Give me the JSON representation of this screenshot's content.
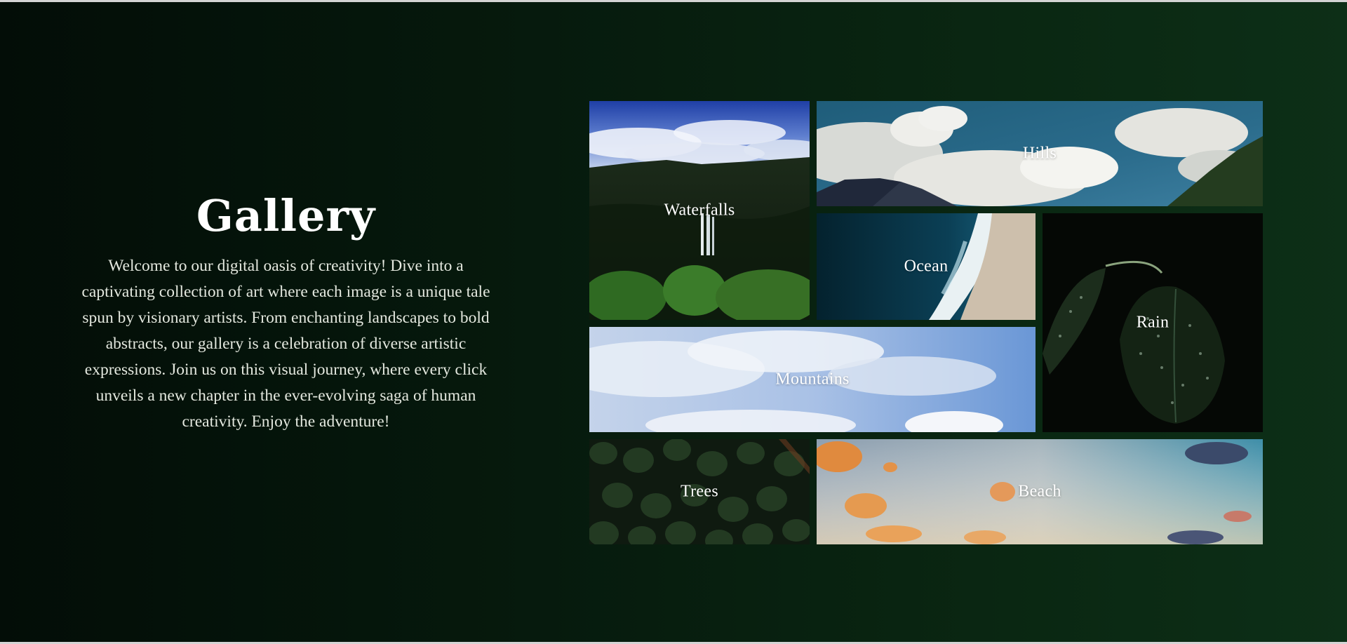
{
  "intro": {
    "title": "Gallery",
    "description": "Welcome to our digital oasis of creativity! Dive into a captivating collection of art where each image is a unique tale spun by visionary artists. From enchanting landscapes to bold abstracts, our gallery is a celebration of diverse artistic expressions. Join us on this visual journey, where every click unveils a new chapter in the ever-evolving saga of human creativity. Enjoy the adventure!"
  },
  "gallery": {
    "items": [
      {
        "label": "Waterfalls"
      },
      {
        "label": "Hills"
      },
      {
        "label": "Ocean"
      },
      {
        "label": "Rain"
      },
      {
        "label": "Mountains"
      },
      {
        "label": "Trees"
      },
      {
        "label": "Beach"
      }
    ]
  },
  "colors": {
    "background_dark": "#030d07",
    "background_green": "#0d2f17",
    "text": "#ffffff"
  }
}
